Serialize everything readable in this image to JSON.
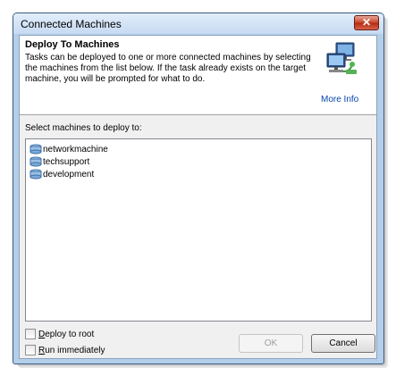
{
  "window": {
    "title": "Connected Machines",
    "close_glyph": "✕"
  },
  "header": {
    "title": "Deploy To Machines",
    "description": "Tasks can be deployed to one or more connected machines by selecting the machines from the list below.  If the task already exists on the target machine, you will be prompted for what to do.",
    "icon": "networked-computer-icon",
    "more_info_link": "More Info"
  },
  "machines": {
    "label": "Select machines to deploy to:",
    "items": [
      {
        "name": "networkmachine",
        "icon": "machine-icon"
      },
      {
        "name": "techsupport",
        "icon": "machine-icon"
      },
      {
        "name": "development",
        "icon": "machine-icon"
      }
    ]
  },
  "options": {
    "deploy_to_root": {
      "label_key": "D",
      "label_rest": "eploy to root",
      "checked": false
    },
    "run_immediately": {
      "label_key": "R",
      "label_rest": "un immediately",
      "checked": false
    }
  },
  "buttons": {
    "ok": "OK",
    "cancel": "Cancel"
  },
  "colors": {
    "link": "#0645ad",
    "frame": "#b5cfe9",
    "close": "#c7442a"
  }
}
